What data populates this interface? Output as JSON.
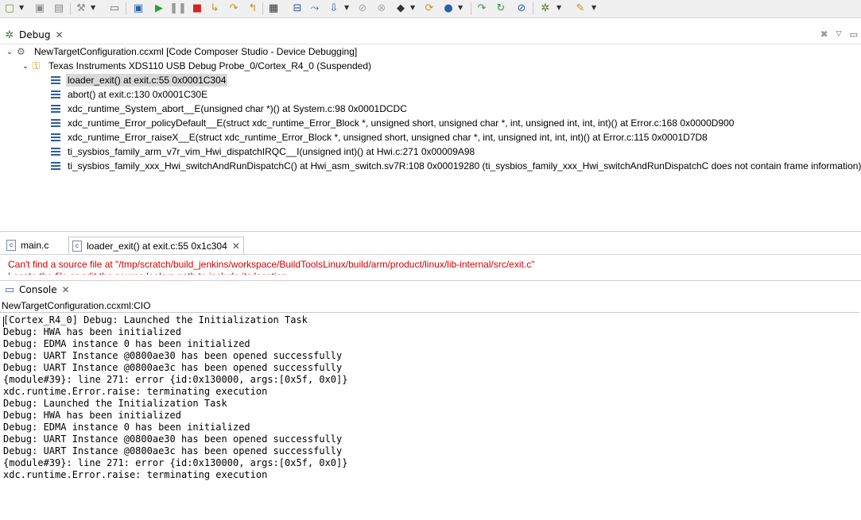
{
  "toolbar": {
    "icons": [
      "new-icon",
      "save-icon",
      "save-all-icon",
      "build-icon",
      "open-console-icon",
      "debug-icon",
      "resume-icon",
      "suspend-icon",
      "terminate-icon",
      "step-into-icon",
      "step-over-icon",
      "step-return-icon",
      "grid-icon",
      "connect-target-icon",
      "restart-icon",
      "load-program-icon",
      "breakpoint-icon",
      "erase-icon",
      "memory-icon",
      "run-icon",
      "run-to-line-icon",
      "step-assembly-icon",
      "step-over-assembly-icon",
      "refresh-icon",
      "tools-icon",
      "pin-icon"
    ]
  },
  "debug_view": {
    "tab_label": "Debug",
    "root": "NewTargetConfiguration.ccxml [Code Composer Studio - Device Debugging]",
    "probe": "Texas Instruments XDS110 USB Debug Probe_0/Cortex_R4_0 (Suspended)",
    "frames": [
      "loader_exit() at exit.c:55 0x0001C304",
      "abort() at exit.c:130 0x0001C30E",
      "xdc_runtime_System_abort__E(unsigned char *)() at System.c:98 0x0001DCDC",
      "xdc_runtime_Error_policyDefault__E(struct xdc_runtime_Error_Block *, unsigned short, unsigned char *, int, unsigned int, int, int)() at Error.c:168 0x0000D900",
      "xdc_runtime_Error_raiseX__E(struct xdc_runtime_Error_Block *, unsigned short, unsigned char *, int, unsigned int, int, int)() at Error.c:115 0x0001D7D8",
      "ti_sysbios_family_arm_v7r_vim_Hwi_dispatchIRQC__I(unsigned int)() at Hwi.c:271 0x00009A98",
      "ti_sysbios_family_xxx_Hwi_switchAndRunDispatchC() at Hwi_asm_switch.sv7R:108 0x00019280  (ti_sysbios_family_xxx_Hwi_switchAndRunDispatchC does not contain frame information)"
    ]
  },
  "editor": {
    "tab_main": "main.c",
    "tab_loader": "loader_exit() at exit.c:55 0x1c304",
    "tab_main_icon_letter": "c",
    "tab_loader_icon_letter": "c",
    "message": "Can't find a source file at \"/tmp/scratch/build_jenkins/workspace/BuildToolsLinux/build/arm/product/linux/lib-internal/src/exit.c\"",
    "message_cut": "Locate the file or edit the source lookup path to include its location."
  },
  "console": {
    "tab_label": "Console",
    "title": "NewTargetConfiguration.ccxml:CIO",
    "lines": [
      "[Cortex_R4_0] Debug: Launched the Initialization Task",
      "Debug: HWA has been initialized",
      "Debug: EDMA instance 0 has been initialized",
      "Debug: UART Instance @0800ae30 has been opened successfully",
      "Debug: UART Instance @0800ae3c has been opened successfully",
      "{module#39}: line 271: error {id:0x130000, args:[0x5f, 0x0]}",
      "xdc.runtime.Error.raise: terminating execution",
      "Debug: Launched the Initialization Task",
      "Debug: HWA has been initialized",
      "Debug: EDMA instance 0 has been initialized",
      "Debug: UART Instance @0800ae30 has been opened successfully",
      "Debug: UART Instance @0800ae3c has been opened successfully",
      "{module#39}: line 271: error {id:0x130000, args:[0x5f, 0x0]}",
      "xdc.runtime.Error.raise: terminating execution"
    ]
  }
}
